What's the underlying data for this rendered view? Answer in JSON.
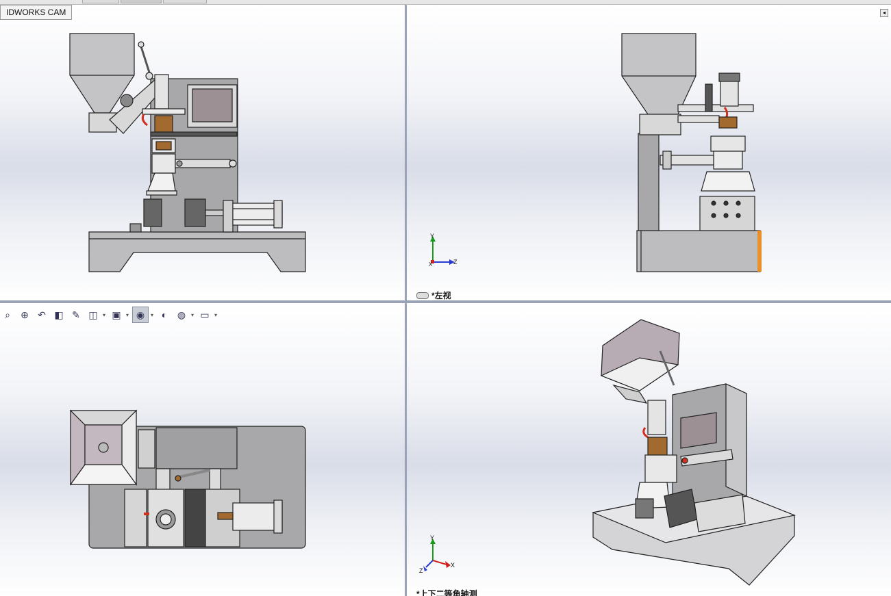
{
  "app": {
    "cam_tab_label": "IDWORKS CAM"
  },
  "views": {
    "left_view_label": "*左视",
    "iso_view_label": "*上下二等角轴测"
  },
  "triad": {
    "y": "Y",
    "z": "Z",
    "x": "X"
  },
  "heads_up_toolbar": {
    "buttons": [
      "zoom-to-fit-icon",
      "zoom-to-area-icon",
      "previous-view-icon",
      "section-view-icon",
      "dynamic-annotation-icon",
      "view-orientation-icon",
      "display-style-icon",
      "hide-show-icon",
      "edit-appearance-icon",
      "apply-scene-icon",
      "view-settings-icon"
    ]
  },
  "colors": {
    "machine_gray": "#a8a8aa",
    "base_fill": "#bdbdbf",
    "screen_fill": "#9c9094",
    "motor_brown": "#a36a2f",
    "accent_red": "#d03020",
    "triad_y": "#1a9a1a",
    "triad_z": "#2a3ad0",
    "triad_x": "#d02020"
  }
}
